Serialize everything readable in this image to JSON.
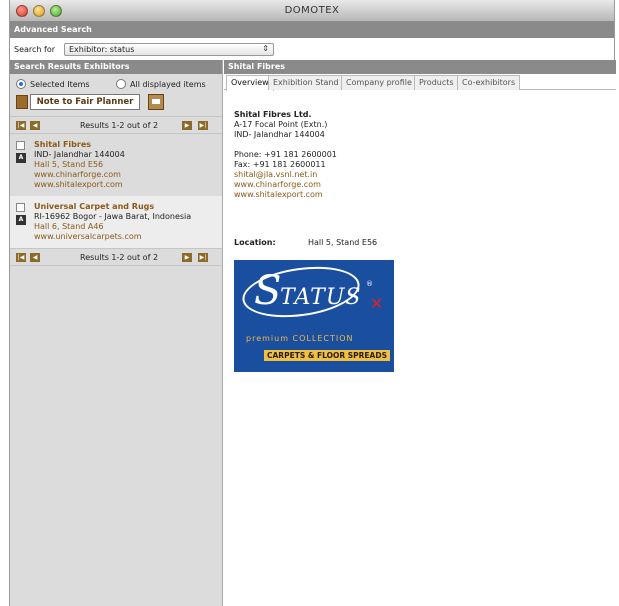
{
  "window": {
    "title": "DOMOTEX"
  },
  "advanced_search": {
    "title": "Advanced Search"
  },
  "search": {
    "label": "Search for",
    "value": "Exhibitor: status"
  },
  "left_panel": {
    "title": "Search Results Exhibitors",
    "selected_items_label": "Selected Items",
    "all_displayed_label": "All displayed items",
    "note_button": "Note to Fair Planner",
    "pager_text": "Results 1-2 out of 2",
    "results": [
      {
        "name": "Shital Fibres",
        "address": "IND- Jalandhar 144004",
        "stand": "Hall 5, Stand E56",
        "web1": "www.chinarforge.com",
        "web2": "www.shitalexport.com"
      },
      {
        "name": "Universal Carpet and Rugs",
        "address": "RI-16962 Bogor - Jawa Barat, Indonesia",
        "stand": "Hall 6, Stand A46",
        "web1": "www.universalcarpets.com",
        "web2": ""
      }
    ]
  },
  "right_panel": {
    "title": "Shital Fibres",
    "tabs": [
      "Overview",
      "Exhibition Stand",
      "Company profile",
      "Products",
      "Co-exhibitors"
    ],
    "company": {
      "name": "Shital Fibres Ltd.",
      "address1": "A-17 Focal Point (Extn.)",
      "address2": "IND- Jalandhar 144004",
      "phone": "Phone: +91 181 2600001",
      "fax": "Fax: +91 181 2600011",
      "email": "shital@jla.vsnl.net.in",
      "web1": "www.chinarforge.com",
      "web2": "www.shitalexport.com"
    },
    "location_label": "Location:",
    "location_value": "Hall 5, Stand E56",
    "logo": {
      "brand": "TATUS",
      "sub": "premium COLLECTION",
      "tagline": "CARPETS & FLOOR SPREADS"
    }
  },
  "colors": {
    "accent": "#8a5a1a",
    "header_gray": "#8a8a8a",
    "logo_blue": "#1a4fa0"
  }
}
